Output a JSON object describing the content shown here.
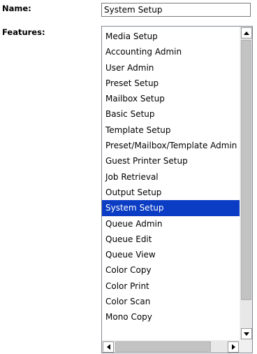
{
  "form": {
    "name_label": "Name:",
    "name_value": "System Setup",
    "features_label": "Features:"
  },
  "features": {
    "selected": "System Setup",
    "items": [
      "Media Setup",
      "Accounting Admin",
      "User Admin",
      "Preset Setup",
      "Mailbox Setup",
      "Basic Setup",
      "Template Setup",
      "Preset/Mailbox/Template Admin",
      "Guest Printer Setup",
      "Job Retrieval",
      "Output Setup",
      "System Setup",
      "Queue Admin",
      "Queue Edit",
      "Queue View",
      "Color Copy",
      "Color Print",
      "Color Scan",
      "Mono Copy"
    ]
  },
  "icons": {
    "scroll_up": "scroll-up-arrow-icon",
    "scroll_down": "scroll-down-arrow-icon",
    "scroll_left": "scroll-left-arrow-icon",
    "scroll_right": "scroll-right-arrow-icon"
  },
  "colors": {
    "selection": "#0a3cc4",
    "selection_text": "#ffffff"
  }
}
